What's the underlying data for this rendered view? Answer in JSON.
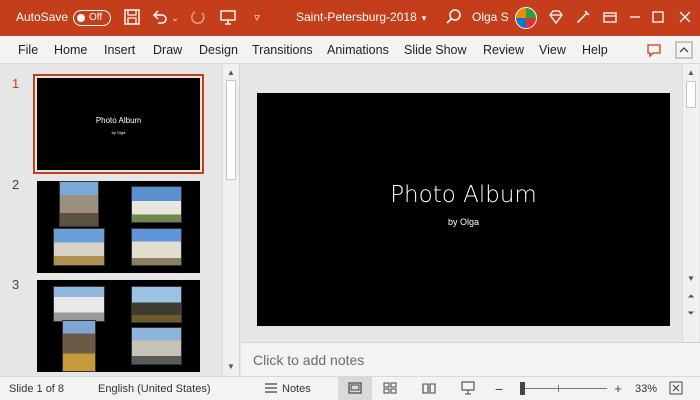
{
  "titlebar": {
    "autosave_label": "AutoSave",
    "autosave_state": "Off",
    "document_title": "Saint-Petersburg-2018",
    "user_name": "Olga S",
    "accent_color": "#c43e1c"
  },
  "menu": {
    "items": [
      "File",
      "Home",
      "Insert",
      "Draw",
      "Design",
      "Transitions",
      "Animations",
      "Slide Show",
      "Review",
      "View",
      "Help"
    ]
  },
  "thumbnails": {
    "slides": [
      {
        "number": "1",
        "title": "Photo Album",
        "subtitle": "by Olga",
        "active": true
      },
      {
        "number": "2",
        "active": false
      },
      {
        "number": "3",
        "active": false
      }
    ]
  },
  "slide": {
    "title": "Photo Album",
    "subtitle": "by Olga"
  },
  "notes": {
    "placeholder": "Click to add notes"
  },
  "status": {
    "slide_indicator": "Slide 1 of 8",
    "language": "English (United States)",
    "notes_label": "Notes",
    "zoom": "33%",
    "zoom_fraction": 0.33
  },
  "icons": {
    "save": "save-icon",
    "undo": "undo-icon",
    "redo": "redo-icon",
    "present": "present-icon",
    "search": "search-icon",
    "diamond": "diamond-icon",
    "pen": "pen-icon",
    "restore": "restore-icon",
    "minimize": "minimize-icon",
    "maximize": "maximize-icon",
    "close": "close-icon",
    "comments": "comments-icon",
    "collapse": "chevron-up-icon"
  }
}
